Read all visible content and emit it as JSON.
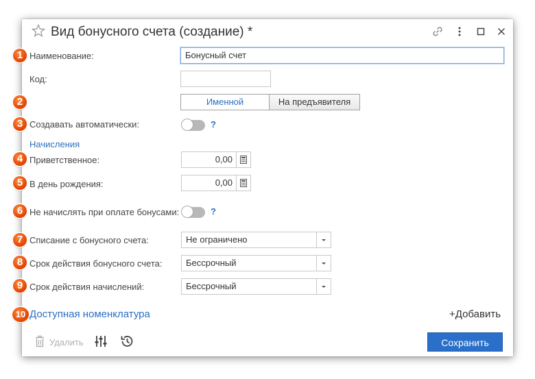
{
  "window": {
    "title": "Вид бонусного счета (создание) *"
  },
  "badges": [
    "1",
    "2",
    "3",
    "4",
    "5",
    "6",
    "7",
    "8",
    "9",
    "10"
  ],
  "fields": {
    "name_label": "Наименование:",
    "name_value": "Бонусный счет",
    "code_label": "Код:",
    "code_value": "",
    "auto_label": "Создавать автоматически:",
    "help_mark": "?",
    "accruals_section": "Начисления",
    "welcome_label": "Приветственное:",
    "welcome_value": "0,00",
    "birthday_label": "В день рождения:",
    "birthday_value": "0,00",
    "no_accrue_label": "Не начислять при оплате бонусами:",
    "writeoff_label": "Списание с бонусного счета:",
    "writeoff_value": "Не ограничено",
    "validity_label": "Срок действия бонусного счета:",
    "validity_value": "Бессрочный",
    "accrual_validity_label": "Срок действия начислений:",
    "accrual_validity_value": "Бессрочный"
  },
  "segmented": {
    "options": [
      "Именной",
      "На предъявителя"
    ],
    "selected": "Именной"
  },
  "toggles": {
    "auto_create": false,
    "no_accrue": false
  },
  "nomenclature": {
    "link": "Доступная номенклатура",
    "add": "+Добавить"
  },
  "footer": {
    "delete_label": "Удалить",
    "save_label": "Сохранить"
  },
  "colors": {
    "accent": "#2a6fc9",
    "link": "#2a6fbf",
    "badge": "#e04000"
  },
  "icons": [
    "star-icon",
    "link-icon",
    "more-icon",
    "maximize-icon",
    "close-icon",
    "calculator-icon",
    "dropdown-arrow-icon",
    "trash-icon",
    "settings-sliders-icon",
    "history-icon"
  ]
}
